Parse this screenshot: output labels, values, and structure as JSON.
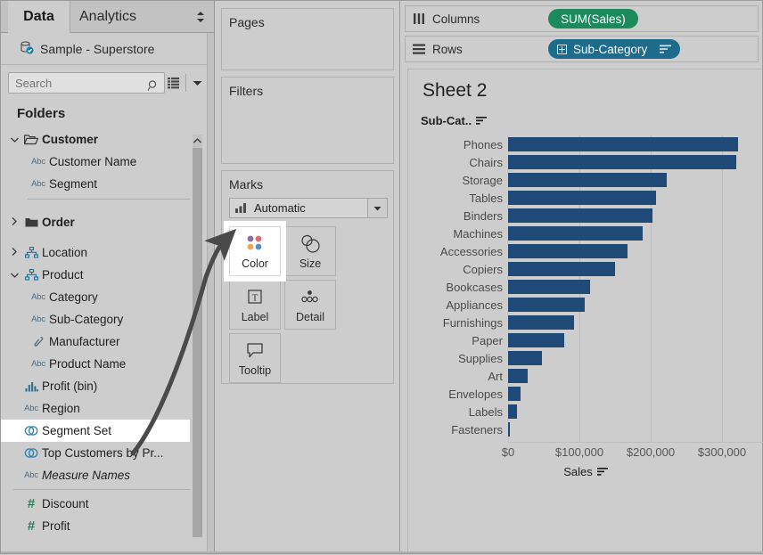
{
  "left_pane": {
    "tabs": [
      {
        "label": "Data",
        "active": true
      },
      {
        "label": "Analytics",
        "active": false
      }
    ],
    "spin_icon": "updown-arrows-icon",
    "datasource": {
      "icon": "database-check-icon",
      "label": "Sample - Superstore"
    },
    "search": {
      "placeholder": "Search",
      "value": "",
      "icon": "search-icon"
    },
    "grid_view_icon": "grid-view-icon",
    "dropdown_icon": "chevron-down-icon",
    "folders_title": "Folders",
    "tree": [
      {
        "id": "customer",
        "label": "Customer",
        "icon": "folder-open-icon",
        "caret": "expanded",
        "bold": true,
        "indent": 0
      },
      {
        "id": "customer-name",
        "label": "Customer Name",
        "icon": "abc-icon",
        "indent": 1
      },
      {
        "id": "segment",
        "label": "Segment",
        "icon": "abc-icon",
        "indent": 1
      },
      {
        "id": "sep-1",
        "type": "separator-indent"
      },
      {
        "id": "spacer-1",
        "type": "spacer"
      },
      {
        "id": "order",
        "label": "Order",
        "icon": "folder-icon",
        "caret": "collapsed",
        "bold": true,
        "indent": 0
      },
      {
        "id": "spacer-2",
        "type": "spacer"
      },
      {
        "id": "location",
        "label": "Location",
        "icon": "hierarchy-icon",
        "caret": "collapsed",
        "indent": 0
      },
      {
        "id": "product",
        "label": "Product",
        "icon": "hierarchy-icon",
        "caret": "expanded",
        "indent": 0
      },
      {
        "id": "category",
        "label": "Category",
        "icon": "abc-icon",
        "indent": 1
      },
      {
        "id": "sub-category",
        "label": "Sub-Category",
        "icon": "abc-icon",
        "indent": 1
      },
      {
        "id": "manufacturer",
        "label": "Manufacturer",
        "icon": "calculated-field-icon",
        "indent": 1
      },
      {
        "id": "product-name",
        "label": "Product Name",
        "icon": "abc-icon",
        "indent": 1
      },
      {
        "id": "profit-bin",
        "label": "Profit (bin)",
        "icon": "bin-icon",
        "indent": 0
      },
      {
        "id": "region",
        "label": "Region",
        "icon": "abc-icon",
        "indent": 0
      },
      {
        "id": "segment-set",
        "label": "Segment Set",
        "icon": "set-icon",
        "indent": 0,
        "highlighted": true
      },
      {
        "id": "top-customers",
        "label": "Top Customers by Pr...",
        "icon": "set-icon",
        "indent": 0
      },
      {
        "id": "measure-names",
        "label": "Measure Names",
        "icon": "abc-icon",
        "indent": 0,
        "italic": true
      },
      {
        "id": "sep-2",
        "type": "separator-full"
      },
      {
        "id": "discount",
        "label": "Discount",
        "icon": "hash-icon",
        "indent": 0
      },
      {
        "id": "profit",
        "label": "Profit",
        "icon": "hash-icon",
        "indent": 0
      }
    ],
    "scrollbar": {
      "up_arrow_icon": "chevron-up-icon"
    }
  },
  "mid_pane": {
    "pages": {
      "title": "Pages"
    },
    "filters": {
      "title": "Filters"
    },
    "marks": {
      "title": "Marks",
      "mark_type": {
        "label": "Automatic",
        "icon": "bar-chart-icon",
        "dropdown_icon": "chevron-down-icon"
      },
      "cards": [
        {
          "id": "color",
          "label": "Color",
          "icon": "color-dots-icon",
          "highlighted": true
        },
        {
          "id": "size",
          "label": "Size",
          "icon": "size-circles-icon",
          "highlighted": false
        },
        {
          "id": "label",
          "label": "Label",
          "icon": "text-label-icon",
          "highlighted": false
        },
        {
          "id": "detail",
          "label": "Detail",
          "icon": "detail-dots-icon",
          "highlighted": false
        },
        {
          "id": "tooltip",
          "label": "Tooltip",
          "icon": "speech-bubble-icon",
          "highlighted": false
        }
      ]
    }
  },
  "shelves": {
    "columns": {
      "label": "Columns",
      "icon": "columns-icon",
      "pills": [
        {
          "text": "SUM(Sales)",
          "color": "#1d8a5e",
          "kind": "measure"
        }
      ]
    },
    "rows": {
      "label": "Rows",
      "icon": "rows-icon",
      "pills": [
        {
          "text": "Sub-Category",
          "color": "#1f6b8c",
          "kind": "dimension",
          "has_plus": true,
          "sort_icon": "sort-descending-icon"
        }
      ]
    }
  },
  "view": {
    "sheet_title": "Sheet 2",
    "row_header": {
      "label": "Sub-Cat..",
      "sort_icon": "sort-descending-icon"
    }
  },
  "chart_data": {
    "type": "bar",
    "orientation": "horizontal",
    "title": "Sheet 2",
    "xlabel": "Sales",
    "ylabel": "Sub-Cat..",
    "xlim": [
      0,
      330000
    ],
    "grid": true,
    "legend": null,
    "bar_color": "#1f4a77",
    "tick_labels": [
      "$0",
      "$100,000",
      "$200,000",
      "$300,000"
    ],
    "tick_values": [
      0,
      100000,
      200000,
      300000
    ],
    "categories": [
      "Phones",
      "Chairs",
      "Storage",
      "Tables",
      "Binders",
      "Machines",
      "Accessories",
      "Copiers",
      "Bookcases",
      "Appliances",
      "Furnishings",
      "Paper",
      "Supplies",
      "Art",
      "Envelopes",
      "Labels",
      "Fasteners"
    ],
    "values": [
      322500,
      320000,
      223000,
      207000,
      203000,
      189000,
      167000,
      150000,
      115000,
      108000,
      92000,
      79000,
      47000,
      27000,
      17000,
      13000,
      3000
    ]
  }
}
